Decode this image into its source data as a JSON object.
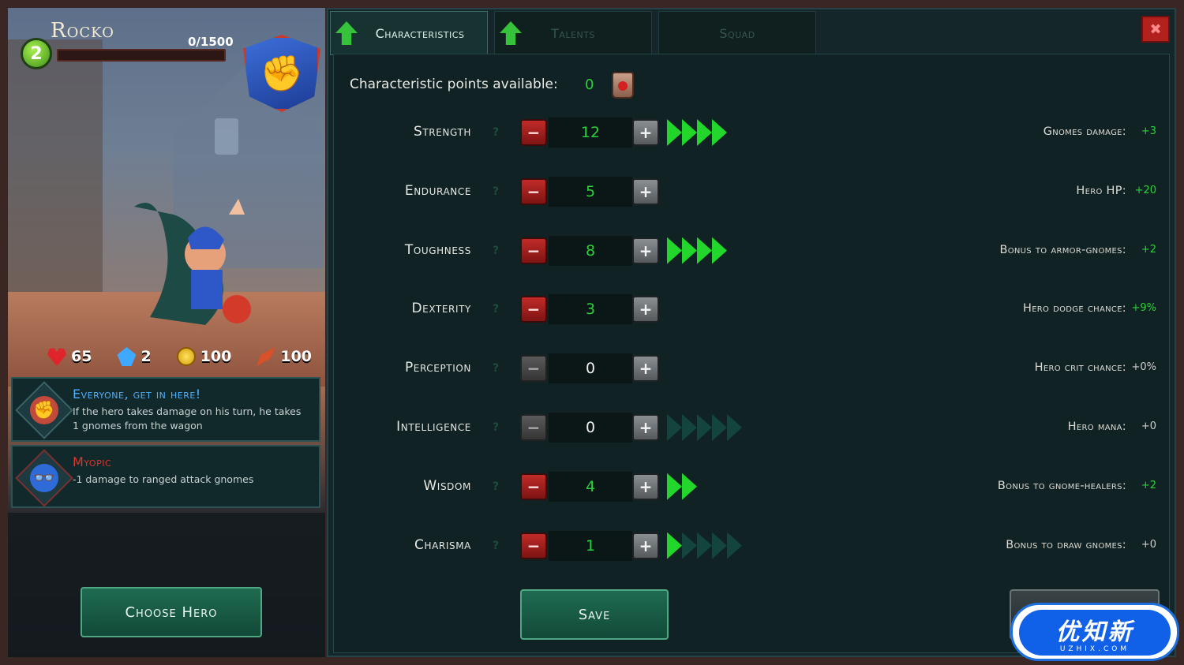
{
  "hero": {
    "name": "Rocko",
    "level": "2",
    "xp_text": "0/1500",
    "xp_progress": 0,
    "class_emblem": "fist-emblem",
    "stats": [
      {
        "icon": "heart-icon",
        "value": "65"
      },
      {
        "icon": "crystal-icon",
        "value": "2"
      },
      {
        "icon": "coin-icon",
        "value": "100"
      },
      {
        "icon": "leaf-icon",
        "value": "100"
      }
    ],
    "perks": [
      {
        "title": "Everyone, get in here!",
        "title_color": "#4fb0ff",
        "description": "If the hero takes damage on his turn, he takes 1 gnomes from the wagon",
        "icon": "fist-perk-icon"
      },
      {
        "title": "Myopic",
        "title_color": "#e0352c",
        "description": "-1 damage to ranged attack gnomes",
        "icon": "glasses-perk-icon"
      }
    ],
    "choose_hero_label": "Choose Hero"
  },
  "tabs": [
    {
      "label": "Characteristics",
      "active": true,
      "has_arrow": true
    },
    {
      "label": "Talents",
      "active": false,
      "has_arrow": true
    },
    {
      "label": "Squad",
      "active": false,
      "has_arrow": false
    }
  ],
  "close_label": "✖",
  "points": {
    "label": "Characteristic points available:",
    "value": "0",
    "icon": "potion-jar-icon"
  },
  "attributes": [
    {
      "name": "Strength",
      "value": "12",
      "value_color": "green",
      "minus_enabled": true,
      "arrows_lit": 4,
      "arrows_total": 4,
      "bonus_label": "Gnomes damage:",
      "bonus_value": "+3",
      "bonus_color": "green"
    },
    {
      "name": "Endurance",
      "value": "5",
      "value_color": "green",
      "minus_enabled": true,
      "arrows_lit": 0,
      "arrows_total": 0,
      "bonus_label": "Hero HP:",
      "bonus_value": "+20",
      "bonus_color": "green"
    },
    {
      "name": "Toughness",
      "value": "8",
      "value_color": "green",
      "minus_enabled": true,
      "arrows_lit": 4,
      "arrows_total": 4,
      "bonus_label": "Bonus to armor-gnomes:",
      "bonus_value": "+2",
      "bonus_color": "green"
    },
    {
      "name": "Dexterity",
      "value": "3",
      "value_color": "green",
      "minus_enabled": true,
      "arrows_lit": 0,
      "arrows_total": 0,
      "bonus_label": "Hero dodge chance:",
      "bonus_value": "+9%",
      "bonus_color": "green"
    },
    {
      "name": "Perception",
      "value": "0",
      "value_color": "white",
      "minus_enabled": false,
      "arrows_lit": 0,
      "arrows_total": 0,
      "bonus_label": "Hero crit chance:",
      "bonus_value": "+0%",
      "bonus_color": "white"
    },
    {
      "name": "Intelligence",
      "value": "0",
      "value_color": "white",
      "minus_enabled": false,
      "arrows_lit": 0,
      "arrows_total": 5,
      "bonus_label": "Hero mana:",
      "bonus_value": "+0",
      "bonus_color": "white"
    },
    {
      "name": "Wisdom",
      "value": "4",
      "value_color": "green",
      "minus_enabled": true,
      "arrows_lit": 2,
      "arrows_total": 2,
      "bonus_label": "Bonus to gnome-healers:",
      "bonus_value": "+2",
      "bonus_color": "green"
    },
    {
      "name": "Charisma",
      "value": "1",
      "value_color": "green",
      "minus_enabled": true,
      "arrows_lit": 1,
      "arrows_total": 5,
      "bonus_label": "Bonus to draw gnomes:",
      "bonus_value": "+0",
      "bonus_color": "white"
    }
  ],
  "save_label": "Save",
  "watermark": {
    "main": "优知新",
    "sub": "UZHIX.COM"
  }
}
